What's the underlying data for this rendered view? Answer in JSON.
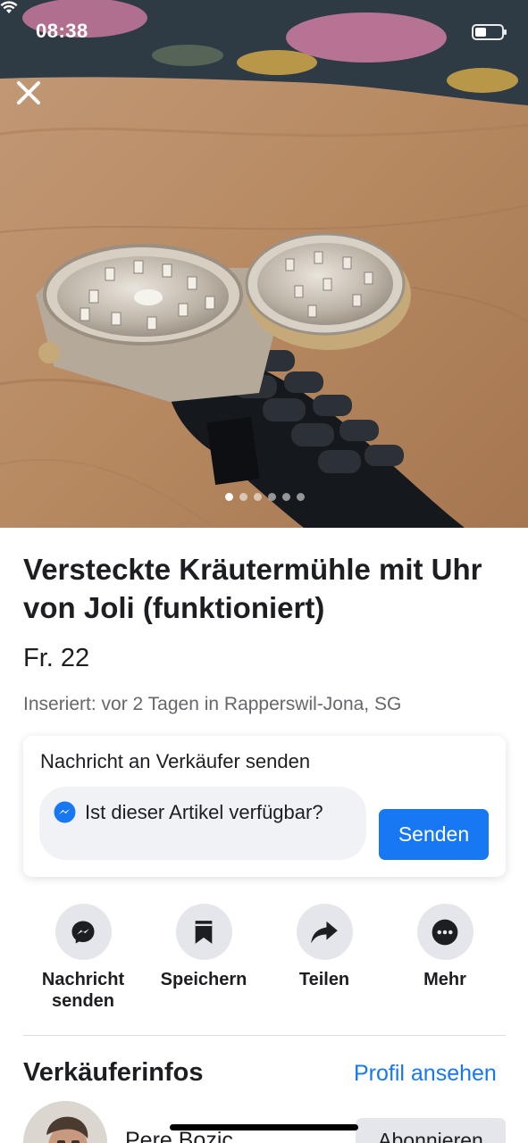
{
  "status_bar": {
    "time": "08:38"
  },
  "photo": {
    "image_count": 6,
    "active_index": 0,
    "close_icon": "close-icon"
  },
  "listing": {
    "title": "Versteckte Kräutermühle mit Uhr von Joli (funktioniert)",
    "price": "Fr. 22",
    "posted": "Inseriert: vor 2 Tagen in Rapperswil-Jona, SG"
  },
  "message_card": {
    "heading": "Nachricht an Verkäufer senden",
    "input_value": "Ist dieser Artikel verfügbar?",
    "send_label": "Senden"
  },
  "actions": [
    {
      "icon": "messenger-icon",
      "label": "Nachricht senden"
    },
    {
      "icon": "bookmark-icon",
      "label": "Speichern"
    },
    {
      "icon": "share-icon",
      "label": "Teilen"
    },
    {
      "icon": "more-icon",
      "label": "Mehr"
    }
  ],
  "seller": {
    "heading": "Verkäuferinfos",
    "profile_link": "Profil ansehen",
    "name": "Pere Bozic",
    "follow_label": "Abonnieren"
  },
  "colors": {
    "accent": "#1877f2",
    "text": "#1c1e21",
    "secondary": "#65676b",
    "chip": "#e4e6eb"
  }
}
